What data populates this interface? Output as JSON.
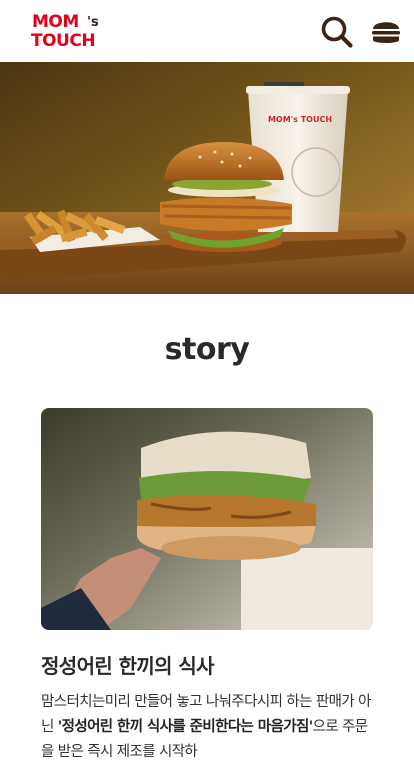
{
  "header": {
    "logo_line1": "MOM",
    "logo_apostrophe": "'s",
    "logo_line2": "TOUCH",
    "search_icon": "search-icon",
    "menu_icon": "burger-menu-icon"
  },
  "hero": {
    "cup_brand": "MOM's TOUCH"
  },
  "story": {
    "title": "story",
    "card": {
      "title": "정성어린 한끼의 식사",
      "desc_part1": "맘스터치는미리 만들어 놓고 나눠주다시피 하는 판매가 아닌 ",
      "desc_bold": "'정성어린 한끼 식사를 준비한다는 마음가짐'",
      "desc_part2": "으로 주문을 받은 즉시 제조를 시작하"
    }
  },
  "colors": {
    "brand_red": "#e3001b",
    "brand_brown": "#3a2416"
  }
}
